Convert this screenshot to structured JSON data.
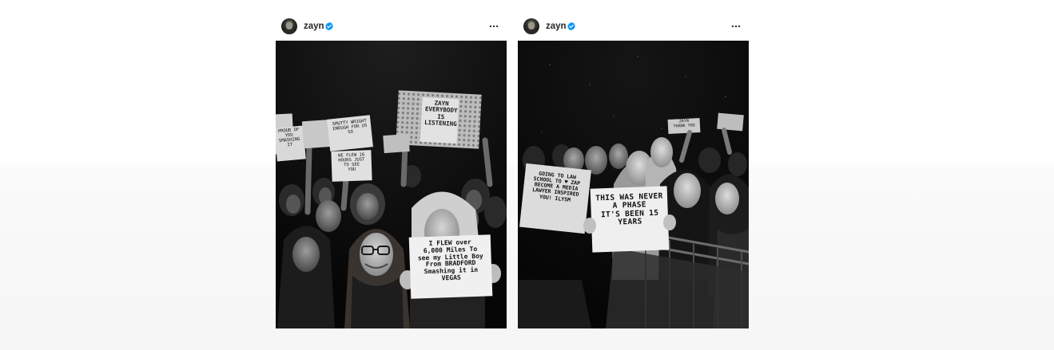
{
  "posts": [
    {
      "username": "zayn",
      "verified_icon": "verified-badge-icon",
      "more_icon": "more-options-icon",
      "signs": {
        "main": "I FLEW over\n6,000 Miles To\nsee my Little Boy\nFrom BRADFORD\nSmashing it in\nVEGAS",
        "top_center": "ZAYN\nEVERYBODY\nIS\nLISTENING",
        "left_smutty": "SMUTTY WRIGHT\nENOUGH FOR US\nSO",
        "left_smashing": "PROUD OF\nYOU\nSMASHING\nIT",
        "left_hours": "WE FLEW 16\nHOURS JUST\nTO SEE\nYOU"
      }
    },
    {
      "username": "zayn",
      "verified_icon": "verified-badge-icon",
      "more_icon": "more-options-icon",
      "signs": {
        "main": "THIS WAS NEVER\nA PHASE\nIT'S BEEN 15\nYEARS",
        "left": "GOING TO LAW\nSCHOOL TO ♥ ZAP\nBECOME A MEDIA\nLAWYER INSPIRED\nYOU! ILYSM",
        "back_right": "ZAYN\nTHANK YOU"
      }
    }
  ],
  "colors": {
    "verified": "#0095f6",
    "username": "#262626",
    "post_bg": "#ffffff"
  }
}
